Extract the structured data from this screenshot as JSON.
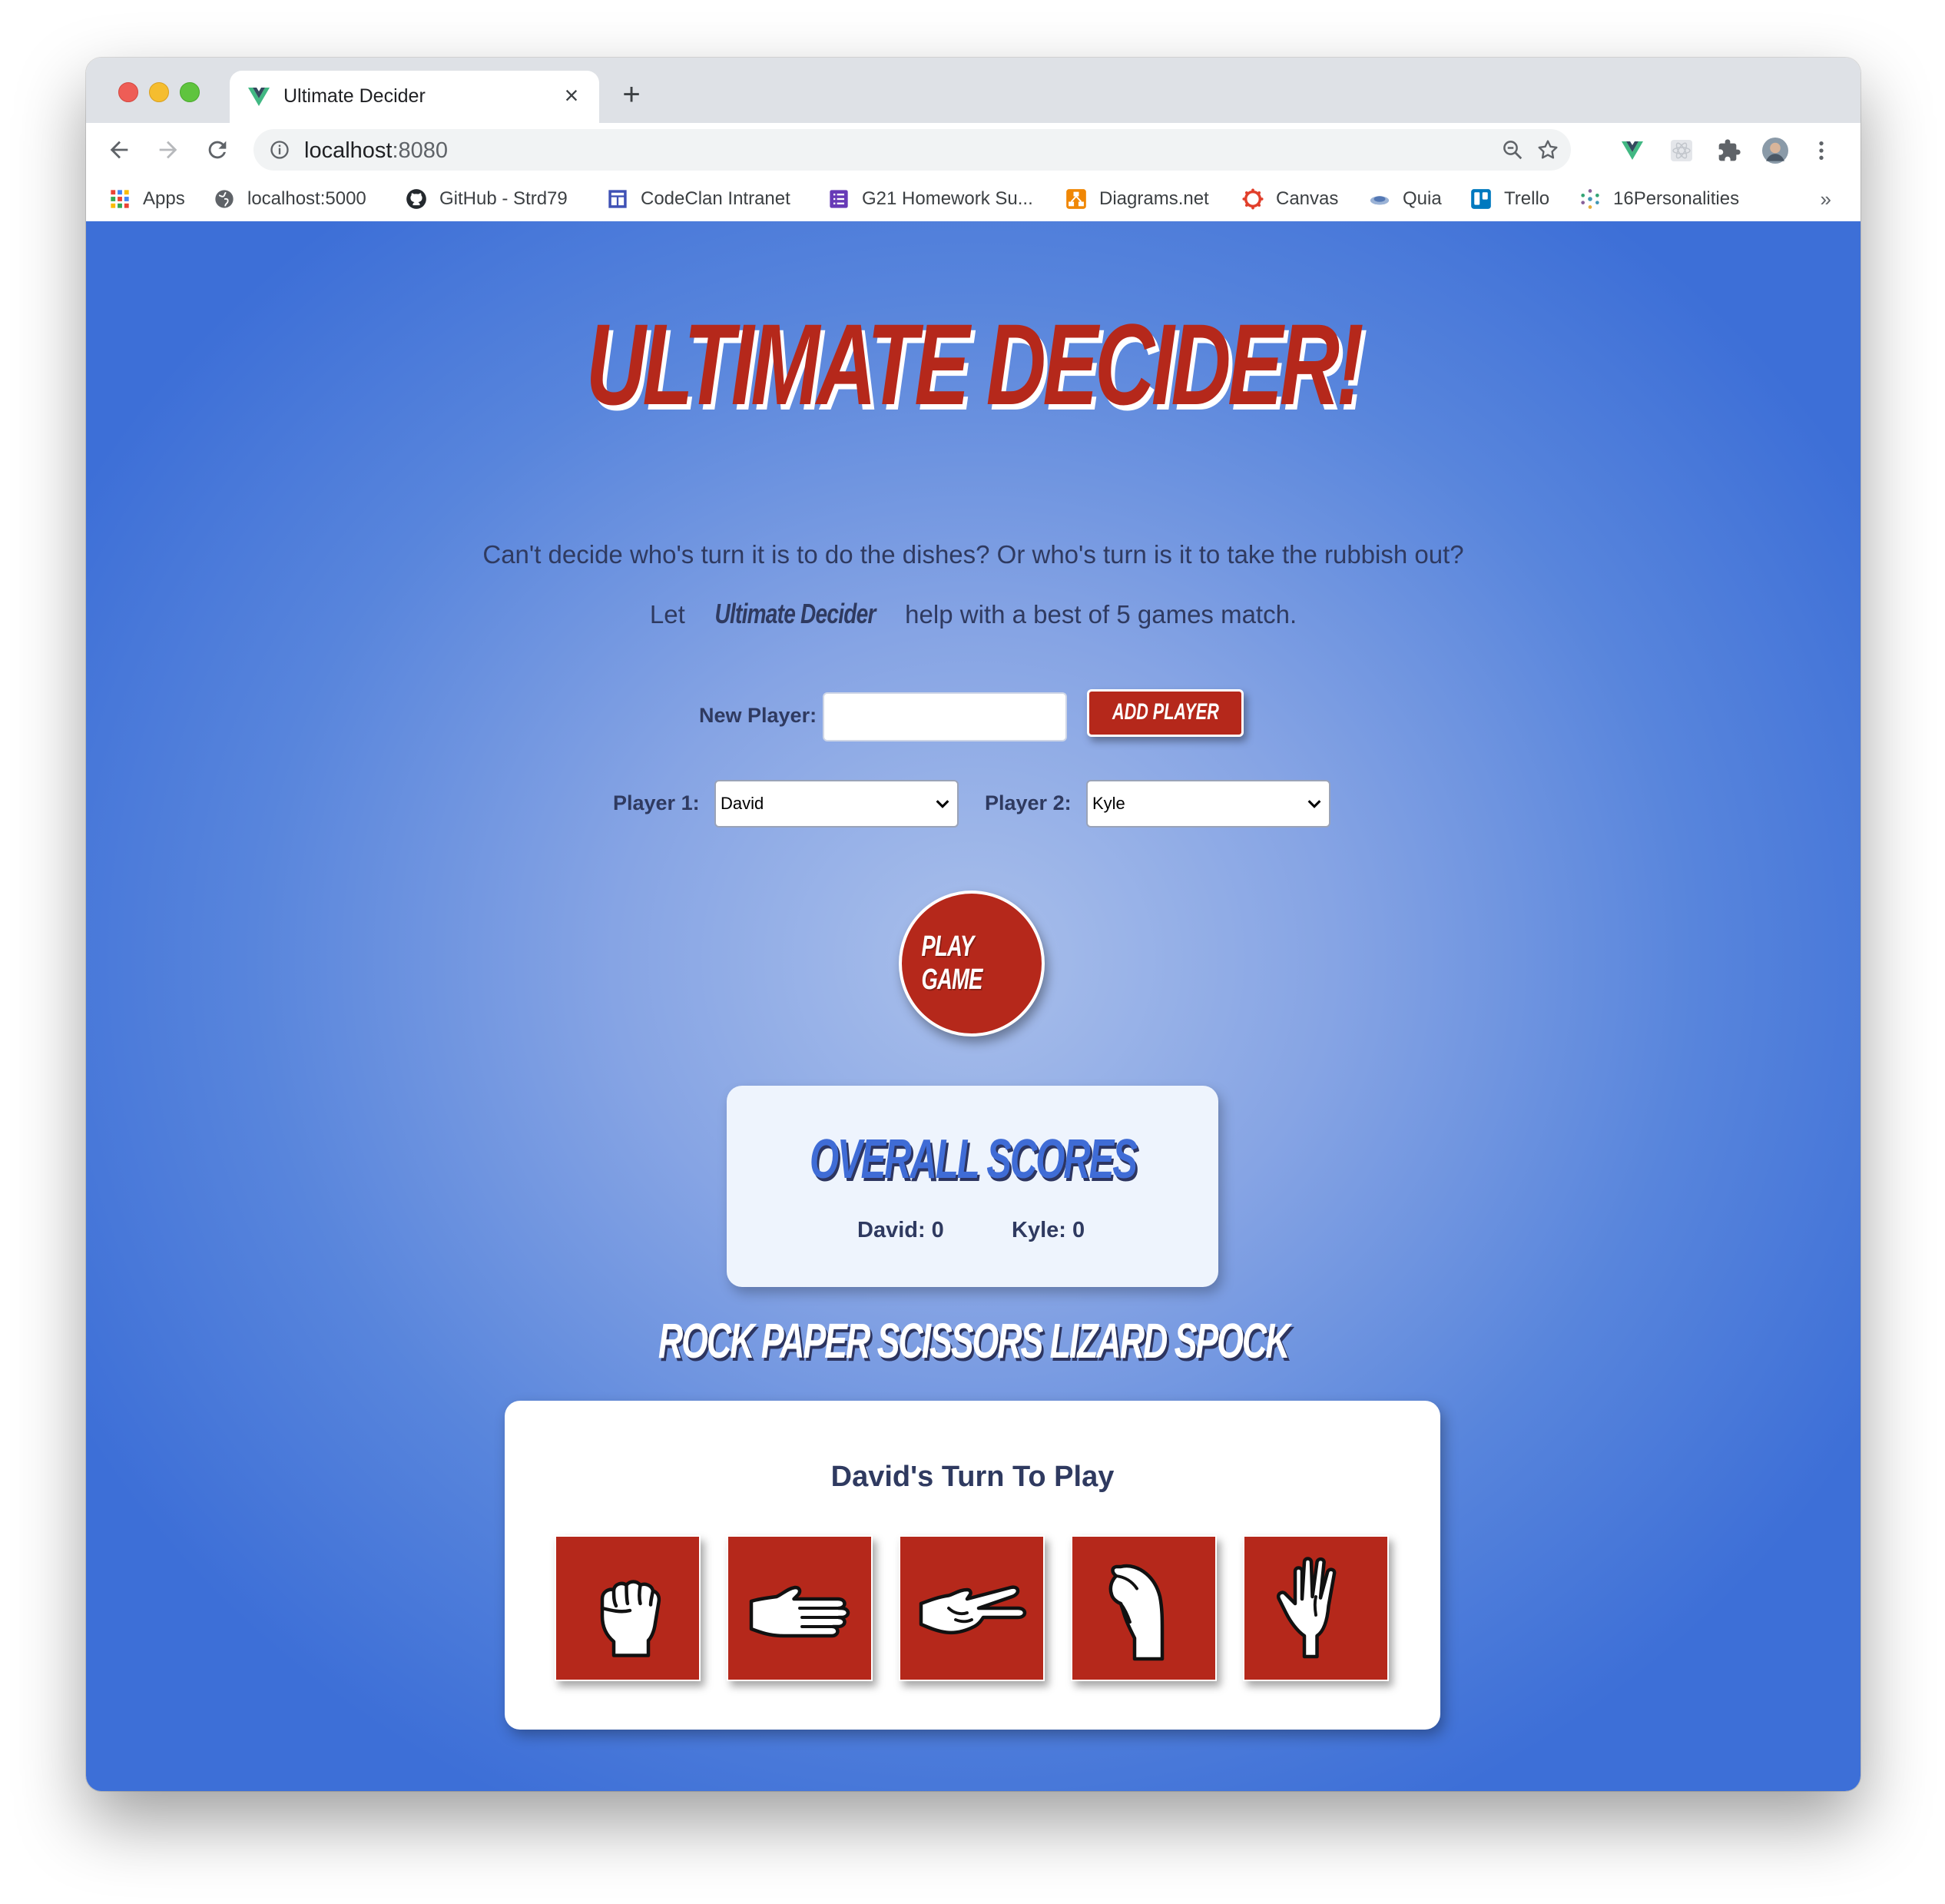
{
  "browser": {
    "tab_title": "Ultimate Decider",
    "url_host": "localhost",
    "url_port": ":8080",
    "bookmarks": [
      {
        "label": "Apps",
        "icon": "apps-grid-icon"
      },
      {
        "label": "localhost:5000",
        "icon": "globe-icon"
      },
      {
        "label": "GitHub - Strd79",
        "icon": "github-icon"
      },
      {
        "label": "CodeClan Intranet",
        "icon": "intranet-icon"
      },
      {
        "label": "G21 Homework Su...",
        "icon": "form-icon"
      },
      {
        "label": "Diagrams.net",
        "icon": "diagrams-icon"
      },
      {
        "label": "Canvas",
        "icon": "canvas-icon"
      },
      {
        "label": "Quia",
        "icon": "quia-icon"
      },
      {
        "label": "Trello",
        "icon": "trello-icon"
      },
      {
        "label": "16Personalities",
        "icon": "personalities-icon"
      }
    ],
    "more_bookmarks": "»"
  },
  "page": {
    "title": "Ultimate Decider!",
    "intro_line1": "Can't decide who's turn it is to do the dishes? Or who's turn is it to take the rubbish out?",
    "intro_line2_pre": "Let ",
    "intro_line2_brand": "Ultimate Decider",
    "intro_line2_post": " help with a best of 5 games match.",
    "new_player_label": "New Player:",
    "new_player_value": "",
    "add_player_label": "Add Player",
    "player1_label": "Player 1:",
    "player1_selected": "David",
    "player2_label": "Player 2:",
    "player2_selected": "Kyle",
    "play_button_label": "Play Game",
    "scores": {
      "title": "Overall Scores",
      "player1": "David: 0",
      "player2": "Kyle: 0"
    },
    "game_title": "Rock Paper Scissors Lizard Spock",
    "turn_text": "David's Turn To Play",
    "moves": [
      {
        "name": "rock",
        "icon": "rock-hand-icon"
      },
      {
        "name": "paper",
        "icon": "paper-hand-icon"
      },
      {
        "name": "scissors",
        "icon": "scissors-hand-icon"
      },
      {
        "name": "lizard",
        "icon": "lizard-hand-icon"
      },
      {
        "name": "spock",
        "icon": "spock-hand-icon"
      }
    ]
  },
  "colors": {
    "accent_red": "#b5281b",
    "page_blue": "#3d6fd7",
    "text_navy": "#2f3a60",
    "score_blue": "#3f6cd6"
  }
}
